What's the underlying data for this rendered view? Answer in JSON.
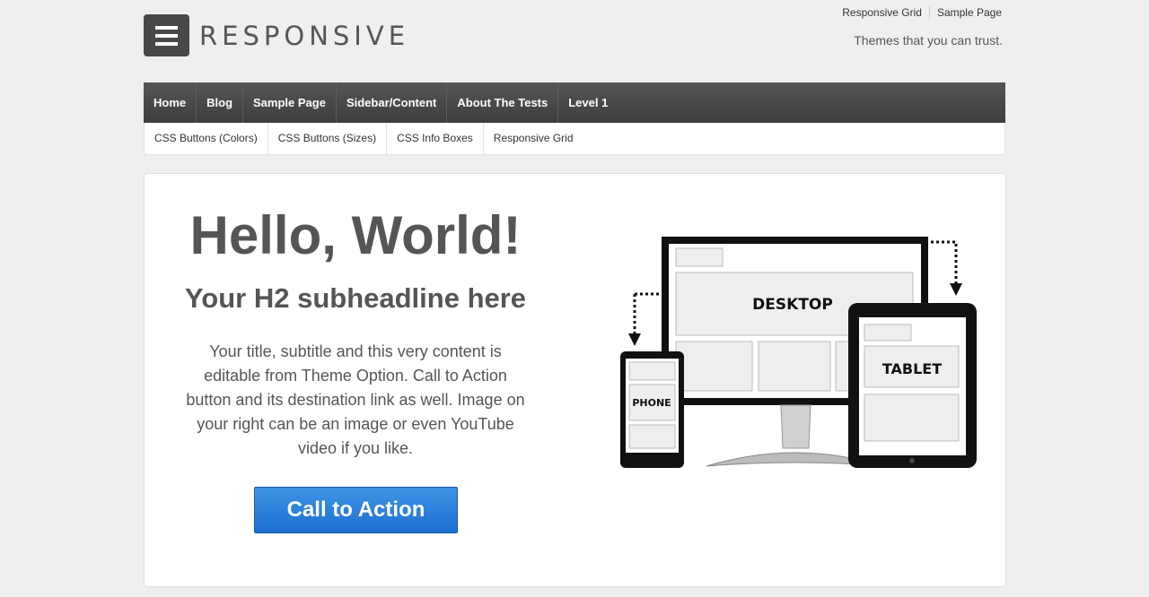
{
  "site": {
    "title": "RESPONSIVE",
    "tagline": "Themes that you can trust."
  },
  "top_menu": [
    {
      "label": "Responsive Grid"
    },
    {
      "label": "Sample Page"
    }
  ],
  "main_menu": [
    {
      "label": "Home"
    },
    {
      "label": "Blog"
    },
    {
      "label": "Sample Page"
    },
    {
      "label": "Sidebar/Content"
    },
    {
      "label": "About The Tests"
    },
    {
      "label": "Level 1"
    }
  ],
  "sub_menu": [
    {
      "label": "CSS Buttons (Colors)"
    },
    {
      "label": "CSS Buttons (Sizes)"
    },
    {
      "label": "CSS Info Boxes"
    },
    {
      "label": "Responsive Grid"
    }
  ],
  "hero": {
    "heading": "Hello, World!",
    "subheading": "Your H2 subheadline here",
    "body": "Your title, subtitle and this very content is editable from Theme Option. Call to Action button and its destination link as well. Image on your right can be an image or even YouTube video if you like.",
    "cta_label": "Call to Action",
    "devices": {
      "desktop": "DESKTOP",
      "tablet": "TABLET",
      "phone": "PHONE"
    }
  },
  "colors": {
    "nav_bg": "#484848",
    "cta": "#2a7fd8",
    "text": "#555555"
  }
}
